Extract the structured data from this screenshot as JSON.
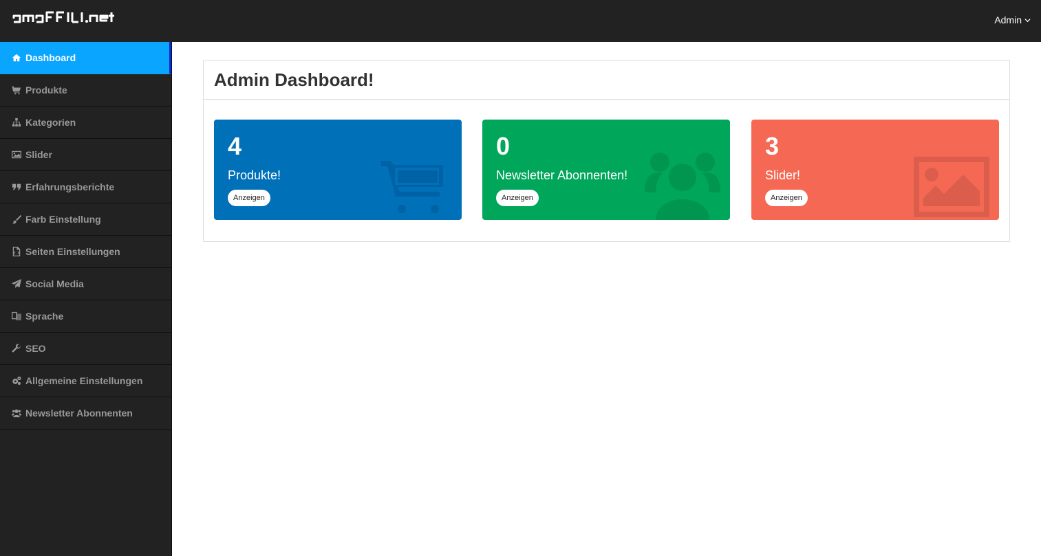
{
  "header": {
    "logo_text": "AMAFFILI.NET",
    "user_menu_label": "Admin"
  },
  "sidebar": {
    "items": [
      {
        "label": "Dashboard",
        "icon": "home-icon",
        "active": true
      },
      {
        "label": "Produkte",
        "icon": "cart-icon"
      },
      {
        "label": "Kategorien",
        "icon": "sitemap-icon"
      },
      {
        "label": "Slider",
        "icon": "image-icon"
      },
      {
        "label": "Erfahrungsberichte",
        "icon": "quote-icon"
      },
      {
        "label": "Farb Einstellung",
        "icon": "paint-brush-icon"
      },
      {
        "label": "Seiten Einstellungen",
        "icon": "file-code-icon"
      },
      {
        "label": "Social Media",
        "icon": "paper-plane-icon"
      },
      {
        "label": "Sprache",
        "icon": "language-icon"
      },
      {
        "label": "SEO",
        "icon": "wrench-icon"
      },
      {
        "label": "Allgemeine Einstellungen",
        "icon": "gears-icon"
      },
      {
        "label": "Newsletter Abonnenten",
        "icon": "users-icon"
      }
    ]
  },
  "main": {
    "title": "Admin Dashboard!",
    "cards": [
      {
        "count": "4",
        "label": "Produkte!",
        "button": "Anzeigen",
        "icon": "cart-icon",
        "color": "#0070b8"
      },
      {
        "count": "0",
        "label": "Newsletter Abonnenten!",
        "button": "Anzeigen",
        "icon": "users-icon",
        "color": "#00a65a"
      },
      {
        "count": "3",
        "label": "Slider!",
        "button": "Anzeigen",
        "icon": "image-icon",
        "color": "#f56954"
      }
    ]
  }
}
